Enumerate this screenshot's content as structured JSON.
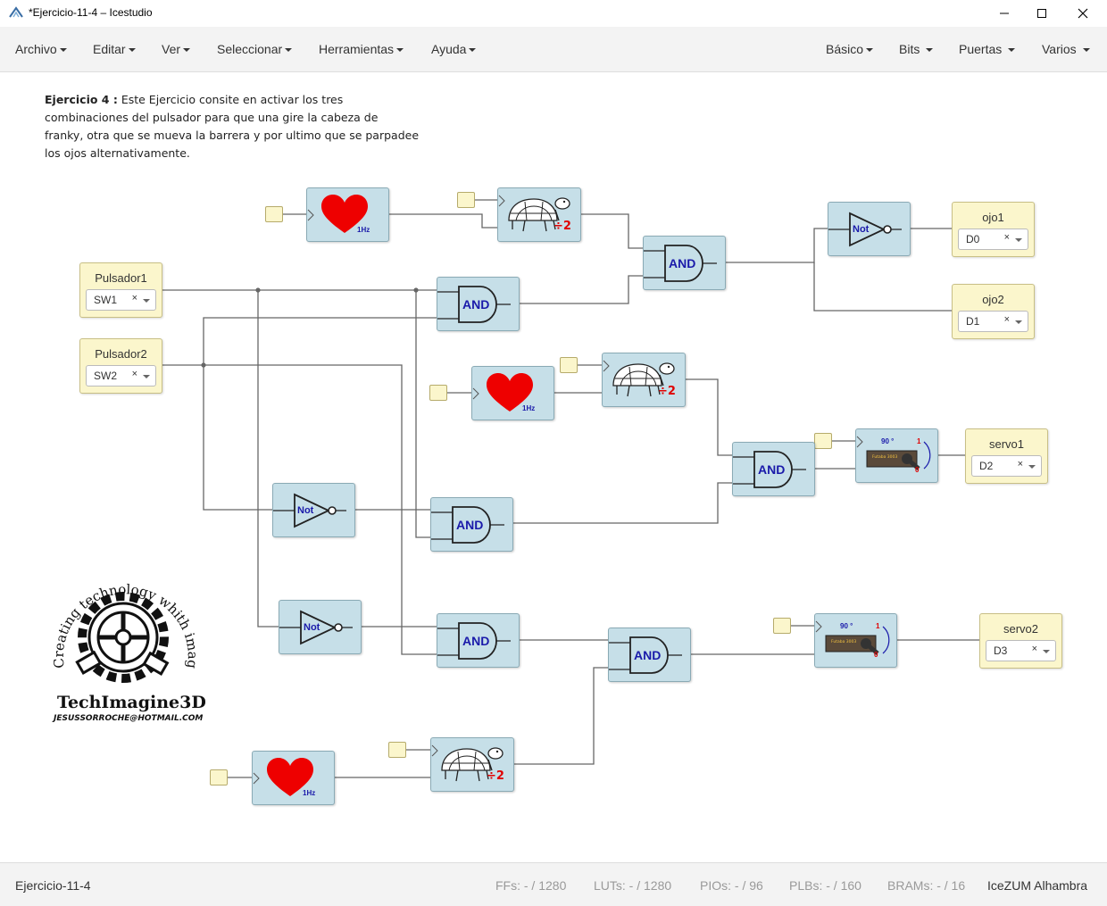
{
  "window": {
    "title": "*Ejercicio-11-4 – Icestudio"
  },
  "menu_left": [
    "Archivo",
    "Editar",
    "Ver",
    "Seleccionar",
    "Herramientas",
    "Ayuda"
  ],
  "menu_right": [
    "Básico",
    "Bits",
    "Puertas",
    "Varios"
  ],
  "description": {
    "bold": "Ejercicio 4 :",
    "text": " Este Ejercicio consite en activar los tres combinaciones del pulsador para que una gire la cabeza de franky, otra que se mueva la barrera y por ultimo que se parpadee los ojos alternativamente."
  },
  "inputs": [
    {
      "label": "Pulsador1",
      "pin": "SW1"
    },
    {
      "label": "Pulsador2",
      "pin": "SW2"
    }
  ],
  "outputs": [
    {
      "label": "ojo1",
      "pin": "D0"
    },
    {
      "label": "ojo2",
      "pin": "D1"
    },
    {
      "label": "servo1",
      "pin": "D2"
    },
    {
      "label": "servo2",
      "pin": "D3"
    }
  ],
  "gates": {
    "and": "AND",
    "not": "Not"
  },
  "clock": {
    "freq": "1Hz"
  },
  "divider": {
    "text": "÷2"
  },
  "servo": {
    "angle": "90 °",
    "one": "1",
    "zero": "0",
    "brand": "Futaba 3003"
  },
  "select_clear": "×",
  "logo": {
    "arc_text": "Creating technology whith imagination",
    "name": "TechImagine3D",
    "email": "JESUSSORROCHE@HOTMAIL.COM"
  },
  "status": {
    "project": "Ejercicio-11-4",
    "ffs": "FFs:  - / 1280",
    "luts": "LUTs:  - / 1280",
    "pios": "PIOs:  - / 96",
    "plbs": "PLBs:  - / 160",
    "brams": "BRAMs:  - / 16",
    "board": "IceZUM Alhambra"
  }
}
